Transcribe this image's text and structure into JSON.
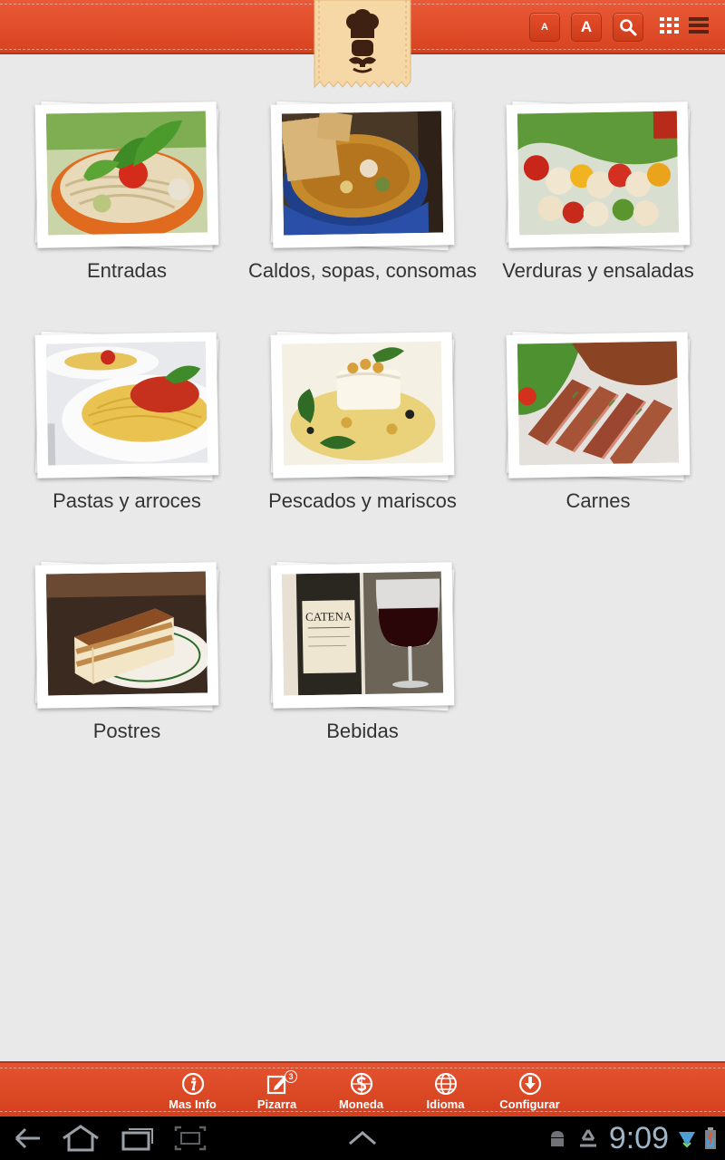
{
  "header": {
    "font_small_label": "A",
    "font_large_label": "A",
    "search_icon": "search-icon",
    "grid_view_icon": "grid-view-icon",
    "list_view_icon": "list-view-icon",
    "brand_color": "#e24a28"
  },
  "categories": [
    {
      "label": "Entradas",
      "image": "salad-photo"
    },
    {
      "label": "Caldos, sopas, consomas",
      "image": "soup-photo"
    },
    {
      "label": "Verduras y ensaladas",
      "image": "skewers-photo"
    },
    {
      "label": "Pastas y arroces",
      "image": "pasta-photo"
    },
    {
      "label": "Pescados y mariscos",
      "image": "fish-photo"
    },
    {
      "label": "Carnes",
      "image": "steak-photo"
    },
    {
      "label": "Postres",
      "image": "tiramisu-photo"
    },
    {
      "label": "Bebidas",
      "image": "wine-photo"
    }
  ],
  "wine_label_text": "CATENA",
  "toolbar": {
    "items": [
      {
        "label": "Mas Info",
        "icon": "info-icon"
      },
      {
        "label": "Pizarra",
        "icon": "edit-icon",
        "badge": "3"
      },
      {
        "label": "Moneda",
        "icon": "currency-icon"
      },
      {
        "label": "Idioma",
        "icon": "globe-icon"
      },
      {
        "label": "Configurar",
        "icon": "download-icon"
      }
    ]
  },
  "system": {
    "clock": "9:09"
  }
}
